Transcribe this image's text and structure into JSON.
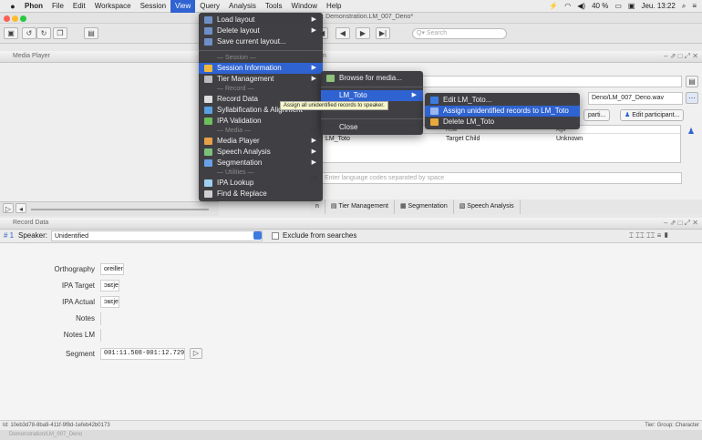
{
  "menubar": {
    "app": "Phon",
    "items": [
      "File",
      "Edit",
      "Workspace",
      "Session",
      "View",
      "Query",
      "Analysis",
      "Tools",
      "Window",
      "Help"
    ],
    "active": "View",
    "status": {
      "battery": "40 %",
      "clock": "Jeu. 13:22"
    }
  },
  "window": {
    "title": "Demonstration.LM_007_Deno*"
  },
  "toolbar": {
    "search_placeholder": "Search"
  },
  "media_panel": {
    "title": "Media Player"
  },
  "session": {
    "media_path": "Deno/LM_007_Deno.wav",
    "add_participant_label": "parti...",
    "edit_participant_label": "Edit participant...",
    "participants_label": "ts",
    "participant_headers": [
      "Role",
      "Age"
    ],
    "participant_rows": [
      {
        "name": "LM_Toto",
        "role": "Target Child",
        "age": "Unknown"
      }
    ],
    "language_label": "ge",
    "language_placeholder": "Enter language codes separated by space",
    "tabs": [
      "Tier Management",
      "Segmentation",
      "Speech Analysis"
    ],
    "tabs_prefix": "n"
  },
  "record": {
    "panel_title": "Record Data",
    "record_number": "1",
    "speaker_label": "Speaker:",
    "speaker_value": "Unidentified",
    "exclude_label": "Exclude from searches",
    "tiers": [
      {
        "label": "Orthography",
        "value": "oreiller"
      },
      {
        "label": "IPA Target",
        "value": "ɔʁɛje"
      },
      {
        "label": "IPA Actual",
        "value": "ɔʁɛje"
      },
      {
        "label": "Notes",
        "value": ""
      },
      {
        "label": "Notes LM",
        "value": ""
      },
      {
        "label": "Segment",
        "value": "001:11.508-001:12.729"
      }
    ]
  },
  "statusbar": {
    "uuid": "Id: 10eb3d78-8ba9-411f-9f8d-1efeb42b0173",
    "right": "Tier: Group: Character"
  },
  "bottom": {
    "doc": "Demonstration/LM_007_Deno"
  },
  "view_menu": {
    "items": [
      {
        "label": "Load layout",
        "type": "item",
        "submenu": true
      },
      {
        "label": "Delete layout",
        "type": "item",
        "submenu": true
      },
      {
        "label": "Save current layout...",
        "type": "item"
      },
      {
        "label": "Session",
        "type": "section"
      },
      {
        "label": "Session Information",
        "type": "item",
        "submenu": true,
        "highlight": true
      },
      {
        "label": "Tier Management",
        "type": "item",
        "submenu": true
      },
      {
        "label": "Record",
        "type": "section"
      },
      {
        "label": "Record Data",
        "type": "item"
      },
      {
        "label": "Syllabification & Alignment",
        "type": "item"
      },
      {
        "label": "IPA Validation",
        "type": "item"
      },
      {
        "label": "Media",
        "type": "section"
      },
      {
        "label": "Media Player",
        "type": "item",
        "submenu": true
      },
      {
        "label": "Speech Analysis",
        "type": "item",
        "submenu": true
      },
      {
        "label": "Segmentation",
        "type": "item",
        "submenu": true
      },
      {
        "label": "Utilities",
        "type": "section"
      },
      {
        "label": "IPA Lookup",
        "type": "item"
      },
      {
        "label": "Find & Replace",
        "type": "item"
      }
    ]
  },
  "session_submenu": {
    "items": [
      "Browse for media...",
      "LM_Toto",
      "Close"
    ]
  },
  "toto_submenu": {
    "items": [
      "Edit LM_Toto...",
      "Assign unidentified records to LM_Toto",
      "Delete LM_Toto"
    ]
  },
  "tooltip": "Assign all unidentified records to speaker."
}
